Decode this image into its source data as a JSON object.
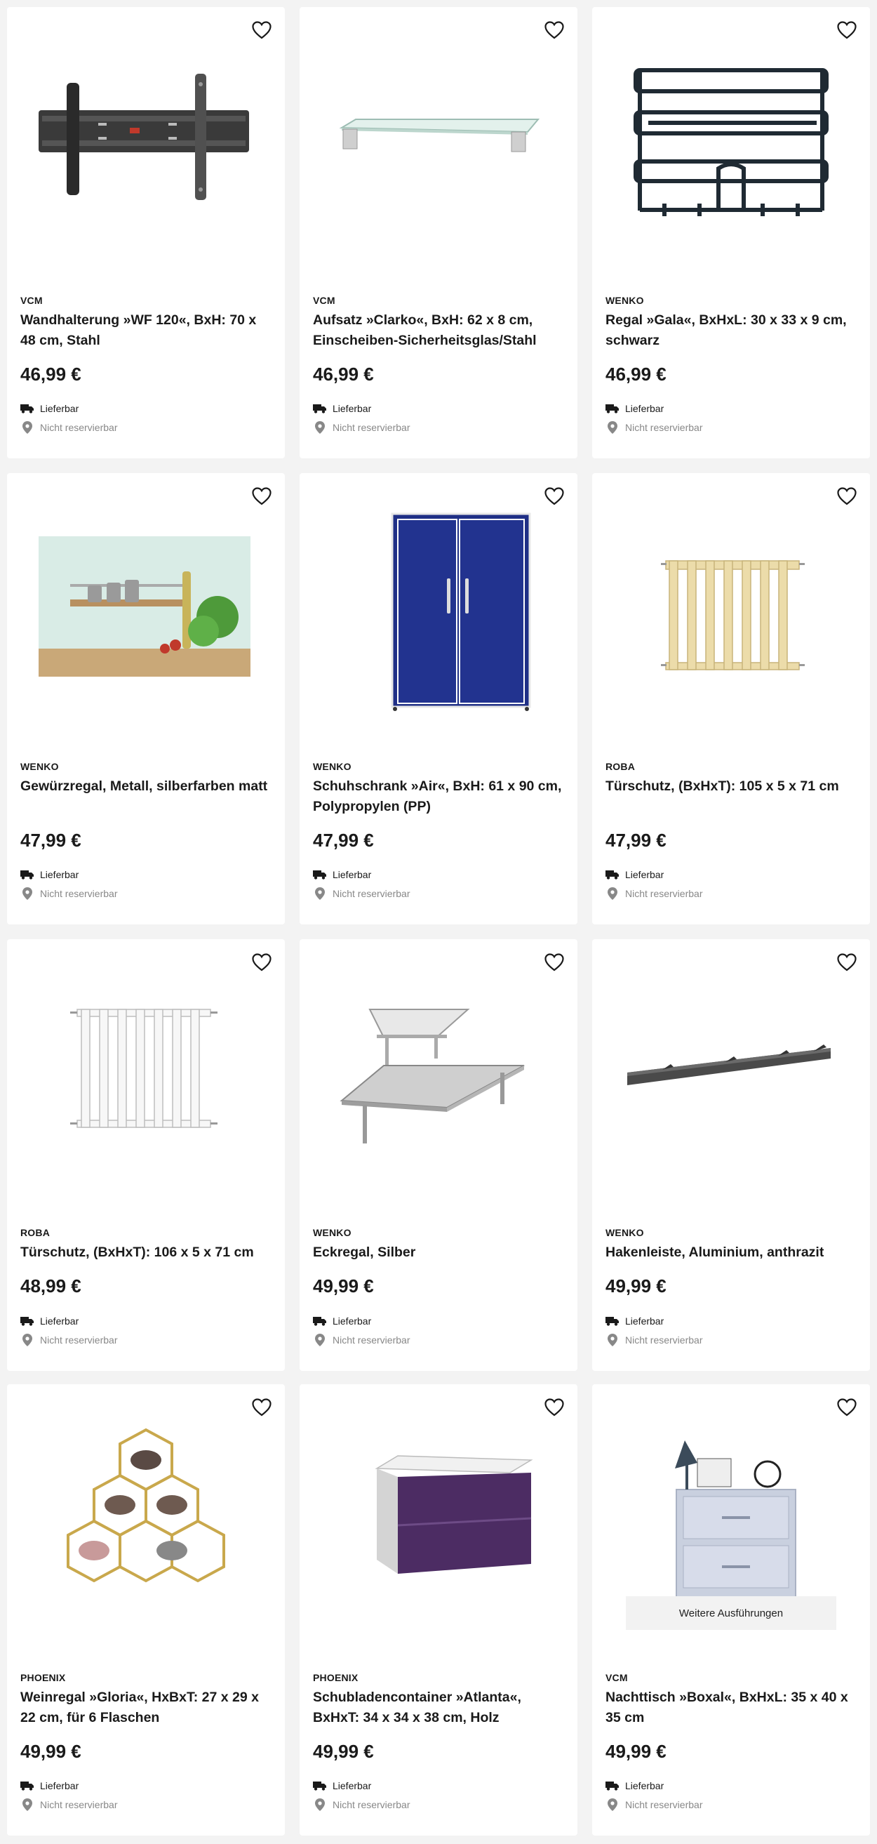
{
  "labels": {
    "delivery": "Lieferbar",
    "reserve": "Nicht reservierbar",
    "variants": "Weitere Ausführungen"
  },
  "products": [
    {
      "brand": "VCM",
      "title": "Wandhalterung »WF 120«, BxH: 70 x 48 cm, Stahl",
      "price": "46,99 €",
      "image": "wall-mount"
    },
    {
      "brand": "VCM",
      "title": "Aufsatz »Clarko«, BxH: 62 x 8 cm, Einscheiben-Sicherheitsglas/Stahl",
      "price": "46,99 €",
      "image": "glass-shelf"
    },
    {
      "brand": "WENKO",
      "title": "Regal »Gala«, BxHxL: 30 x 33 x 9 cm, schwarz",
      "price": "46,99 €",
      "image": "black-rack"
    },
    {
      "brand": "WENKO",
      "title": "Gewürzregal, Metall, silberfarben matt",
      "price": "47,99 €",
      "image": "spice-rack"
    },
    {
      "brand": "WENKO",
      "title": "Schuhschrank »Air«, BxH: 61 x 90 cm, Polypropylen (PP)",
      "price": "47,99 €",
      "image": "blue-cabinet"
    },
    {
      "brand": "ROBA",
      "title": "Türschutz, (BxHxT): 105 x 5 x 71 cm",
      "price": "47,99 €",
      "image": "wood-gate"
    },
    {
      "brand": "ROBA",
      "title": "Türschutz, (BxHxT): 106 x 5 x 71 cm",
      "price": "48,99 €",
      "image": "white-gate"
    },
    {
      "brand": "WENKO",
      "title": "Eckregal, Silber",
      "price": "49,99 €",
      "image": "corner-shelf"
    },
    {
      "brand": "WENKO",
      "title": "Hakenleiste, Aluminium, anthrazit",
      "price": "49,99 €",
      "image": "hook-rail"
    },
    {
      "brand": "PHOENIX",
      "title": "Weinregal »Gloria«, HxBxT: 27 x 29 x 22 cm, für 6 Flaschen",
      "price": "49,99 €",
      "image": "wine-rack"
    },
    {
      "brand": "PHOENIX",
      "title": "Schubladencontainer »Atlanta«, BxHxT: 34 x 34 x 38 cm, Holz",
      "price": "49,99 €",
      "image": "drawer-cube"
    },
    {
      "brand": "VCM",
      "title": "Nachttisch »Boxal«, BxHxL: 35 x 40 x 35 cm",
      "price": "49,99 €",
      "image": "nightstand"
    }
  ],
  "colors": {
    "text": "#1a1a1a",
    "muted": "#888888",
    "background": "#f3f3f3",
    "card": "#ffffff"
  }
}
